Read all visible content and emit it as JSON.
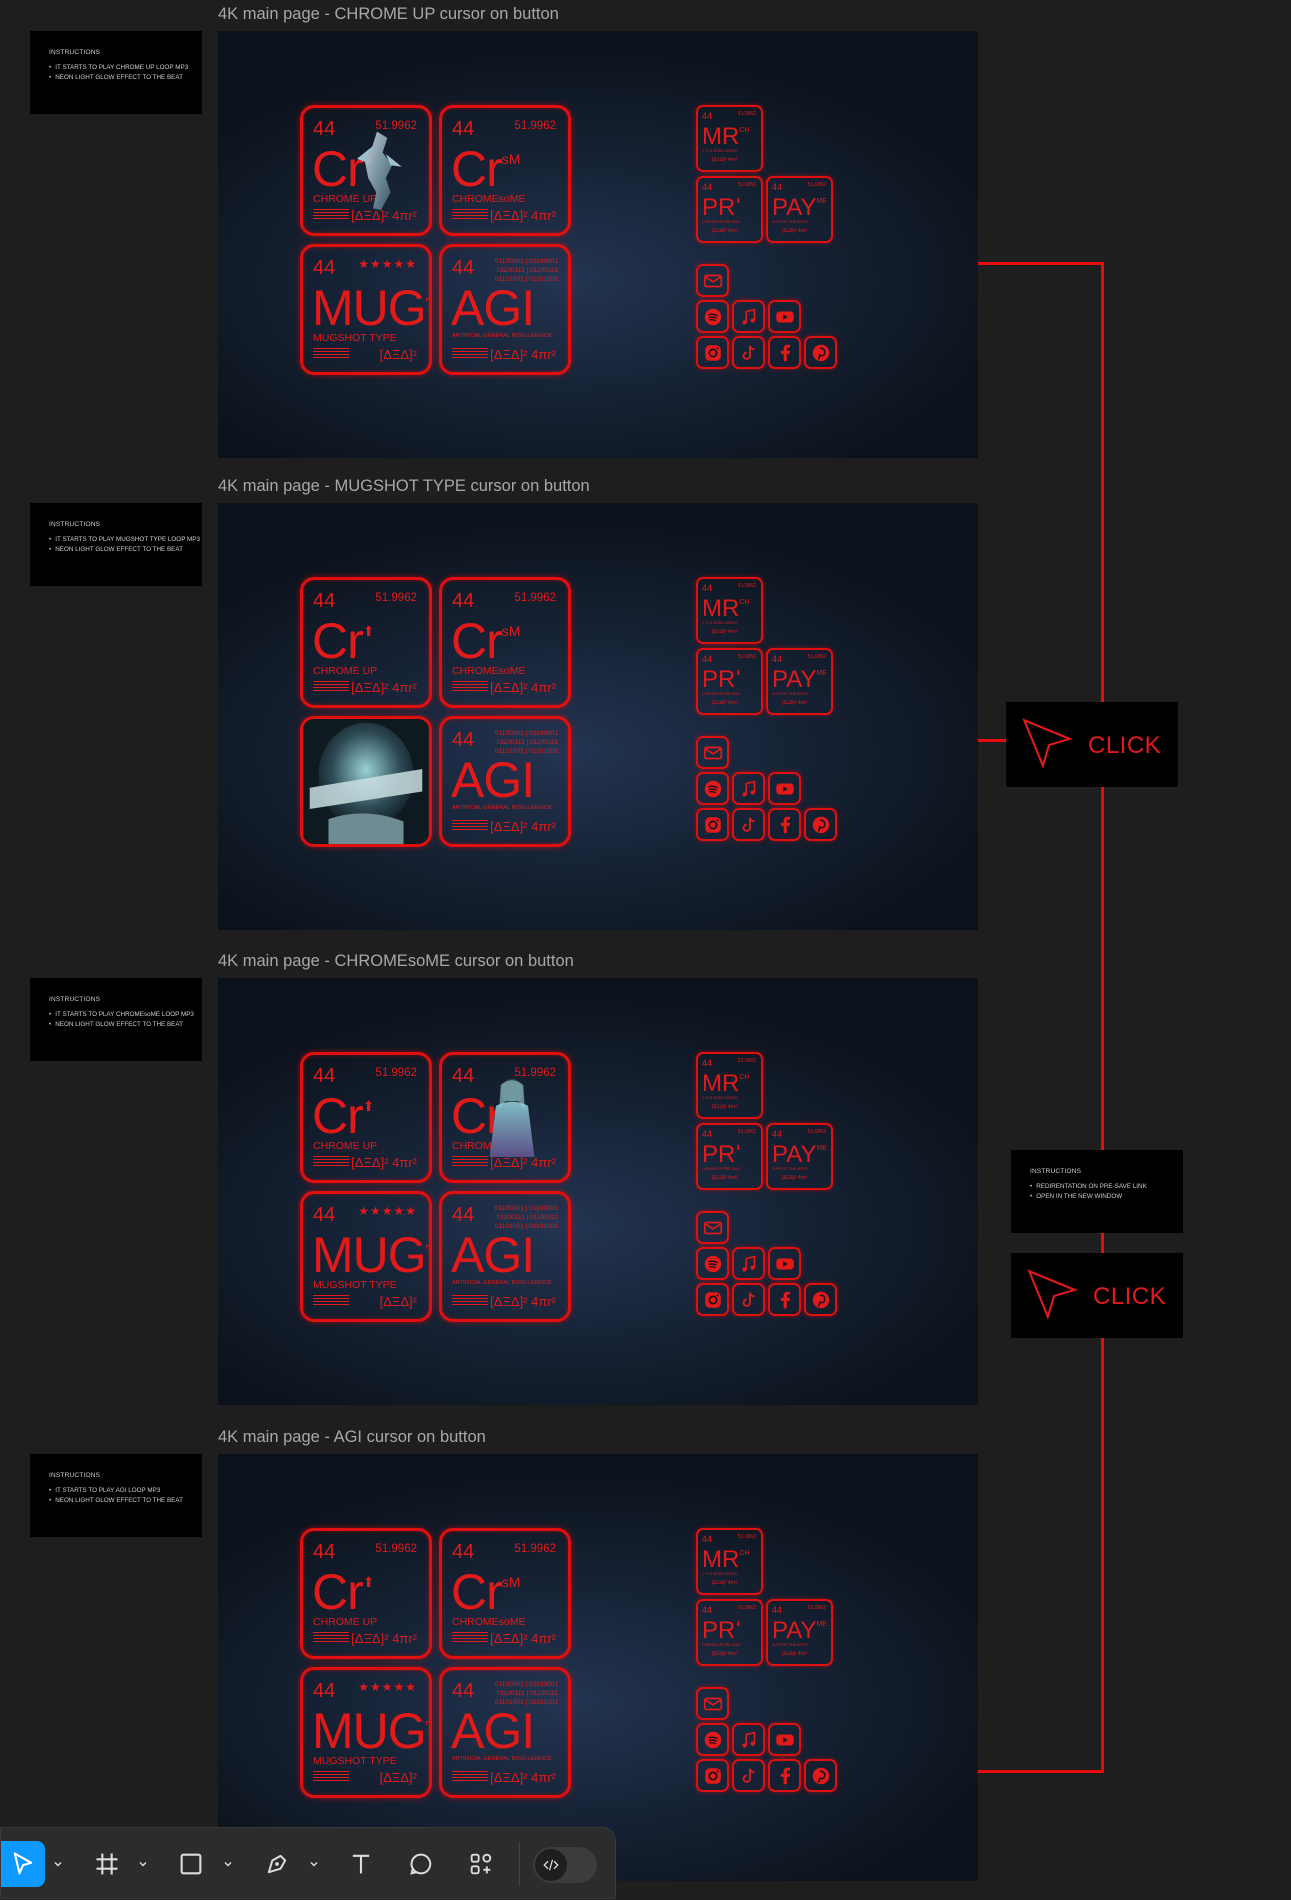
{
  "frames": [
    {
      "title": "4K main page - CHROME UP cursor on button",
      "instructions": {
        "heading": "INSTRUCTIONS",
        "lines": [
          "IT STARTS TO PLAY CHROME UP LOOP MP3",
          "NEON LIGHT GLOW EFFECT TO THE BEAT"
        ]
      },
      "art_on": "chrome-up"
    },
    {
      "title": "4K main page - MUGSHOT TYPE cursor on button",
      "instructions": {
        "heading": "INSTRUCTIONS",
        "lines": [
          "IT STARTS TO PLAY MUGSHOT TYPE LOOP MP3",
          "NEON LIGHT GLOW EFFECT TO THE BEAT"
        ]
      },
      "art_on": "mugshot"
    },
    {
      "title": "4K main page - CHROMEsoME cursor on button",
      "instructions": {
        "heading": "INSTRUCTIONS",
        "lines": [
          "IT STARTS TO PLAY CHROMEsoME LOOP MP3",
          "NEON LIGHT GLOW EFFECT TO THE BEAT"
        ]
      },
      "art_on": "chromesome"
    },
    {
      "title": "4K main page - AGI cursor on button",
      "instructions": {
        "heading": "INSTRUCTIONS",
        "lines": [
          "IT STARTS TO PLAY AGI LOOP MP3",
          "NEON LIGHT GLOW EFFECT TO THE BEAT"
        ]
      },
      "art_on": "agi"
    }
  ],
  "tiles": {
    "chrome_up": {
      "num": "44",
      "mass": "51.9962",
      "symbol": "Cr",
      "sup": "⬆",
      "sub": "CHROME UP",
      "foot": "[ΔΞΔ]² 4πr²"
    },
    "chromesome": {
      "num": "44",
      "mass": "51.9962",
      "symbol": "Cr",
      "sup": "sM",
      "sub": "CHROMEsoME",
      "foot": "[ΔΞΔ]² 4πr²"
    },
    "mugshot": {
      "num": "44",
      "stars": "★★★★★",
      "symbol": "MUG",
      "sup": "⌐",
      "sub": "MUGSHOT TYPE",
      "foot": "[ΔΞΔ]²"
    },
    "agi": {
      "num": "44",
      "binary": [
        "01100001 | 01100001",
        "01100111 | 01100111",
        "01101001 | 01101001"
      ],
      "symbol": "AGI",
      "sub": "ARTIFICIAL GENERAL INTELLIGENCE",
      "foot": "[ΔΞΔ]² 4πr²"
    }
  },
  "small_tiles": {
    "merch": {
      "num": "44",
      "mass": "51.9962",
      "symbol": "MR",
      "sup": "CH",
      "sub": "1 TO 8 WONG MERCH",
      "foot": "[ΔΞΔ]² 4πr²"
    },
    "presave": {
      "num": "44",
      "mass": "51.9962",
      "symbol": "PR",
      "sup": "⬇",
      "sub": "CHROME UP PRE-SAVE",
      "foot": "[ΔΞΔ]² 4πr²"
    },
    "pay": {
      "num": "44",
      "mass": "51.9962",
      "symbol": "PAY",
      "sup": "ME",
      "sub": "SUPPORT THE ARTIST",
      "foot": "[ΔΞΔ]² 4πr²"
    }
  },
  "socials": [
    "mail-icon",
    "spotify-icon",
    "apple-music-icon",
    "youtube-icon",
    "instagram-icon",
    "tiktok-icon",
    "facebook-icon",
    "pinterest-icon"
  ],
  "side": {
    "click_label": "CLICK",
    "instructions": {
      "heading": "INSTRUCTIONS",
      "lines": [
        "REDIRENTATION ON PRE-SAVE LINK",
        "OPEN IN THE NEW WINDOW"
      ]
    }
  },
  "toolbar": {
    "tools": [
      "move-tool",
      "frame-tool",
      "shape-tool",
      "pen-tool",
      "text-tool",
      "comment-tool",
      "actions-tool",
      "dev-mode-toggle"
    ]
  },
  "colors": {
    "neon_red": "#e31a1a",
    "background": "#1e1e1e",
    "selected_tool": "#0d99ff"
  }
}
